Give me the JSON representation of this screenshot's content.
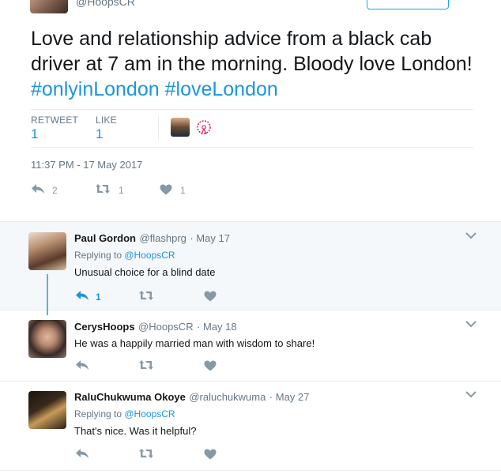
{
  "original": {
    "handle": "@HoopsCR",
    "text_main": "Love and relationship advice from a black cab driver at 7 am in the morning. Bloody love London! ",
    "hashtag1": "#onlyinLondon",
    "hashtag2": "#loveLondon",
    "retweet_label": "RETWEET",
    "retweet_count": "1",
    "like_label": "LIKE",
    "like_count": "1",
    "timestamp": "11:37 PM - 17 May 2017",
    "actions": {
      "reply_count": "2",
      "retweet_count": "1",
      "like_count": "1"
    }
  },
  "replies": [
    {
      "name": "Paul Gordon",
      "handle": "@flashprg",
      "date": "· May 17",
      "replying_prefix": "Replying to ",
      "replying_to": "@HoopsCR",
      "text": "Unusual choice for a blind date",
      "reply_count": "1"
    },
    {
      "name": "CerysHoops",
      "handle": "@HoopsCR",
      "date": "· May 18",
      "text": "He was a happily married man with wisdom to share!"
    },
    {
      "name": "RaluChukwuma Okoye",
      "handle": "@raluchukwuma",
      "date": "· May 27",
      "replying_prefix": "Replying to ",
      "replying_to": "@HoopsCR",
      "text": "That's nice. Was it helpful?"
    }
  ],
  "colors": {
    "link": "#1b95e0",
    "muted": "#657786",
    "icon": "#8899a6",
    "highlight_bg": "#f5f8fa",
    "thread_line": "#5fb3c9"
  },
  "icons": [
    "reply-icon",
    "retweet-icon",
    "heart-icon",
    "chevron-down-icon"
  ]
}
